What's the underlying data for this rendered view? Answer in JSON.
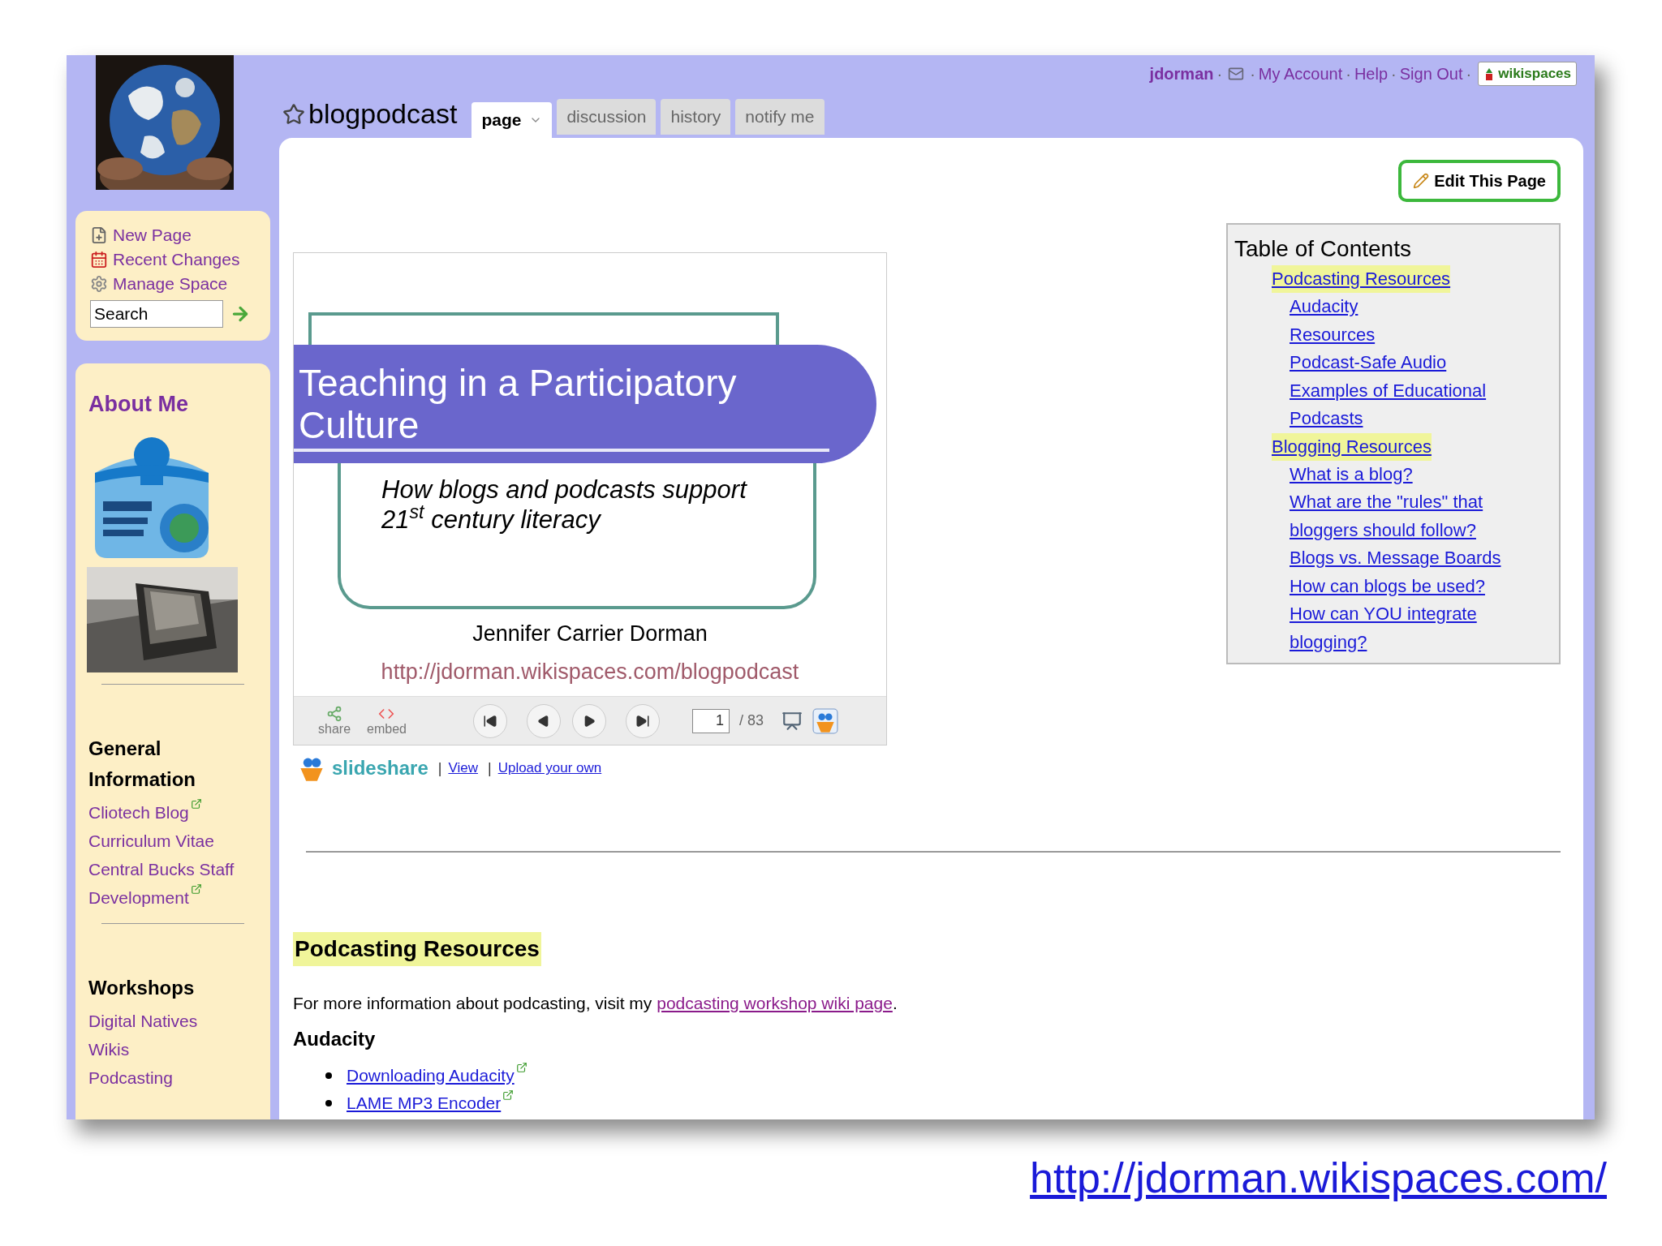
{
  "user_bar": {
    "username": "jdorman",
    "links": [
      "My Account",
      "Help",
      "Sign Out"
    ],
    "brand": "wikispaces",
    "separator": "·"
  },
  "page_title": "blogpodcast",
  "tabs": [
    {
      "label": "page",
      "selected": true,
      "dropdown": true
    },
    {
      "label": "discussion",
      "selected": false,
      "dropdown": false
    },
    {
      "label": "history",
      "selected": false,
      "dropdown": false
    },
    {
      "label": "notify me",
      "selected": false,
      "dropdown": false
    }
  ],
  "sidebar": {
    "actions": [
      {
        "label": "New Page",
        "kind": "new"
      },
      {
        "label": "Recent Changes",
        "kind": "calendar"
      },
      {
        "label": "Manage Space",
        "kind": "gear"
      }
    ],
    "search": {
      "value": "Search"
    },
    "about_title": "About Me",
    "sections": [
      {
        "title": "General Information",
        "links": [
          {
            "label": "Cliotech Blog",
            "external": true
          },
          {
            "label": "Curriculum Vitae",
            "external": false
          },
          {
            "label": "Central Bucks Staff Development",
            "external": true
          }
        ]
      },
      {
        "title": "Workshops",
        "links": [
          {
            "label": "Digital Natives",
            "external": false
          },
          {
            "label": "Wikis",
            "external": false
          },
          {
            "label": "Podcasting",
            "external": false
          }
        ]
      }
    ]
  },
  "edit_button": "Edit This Page",
  "slideshow": {
    "title": "Teaching in a Participatory Culture",
    "subtitle": "How blogs and podcasts support 21$^{st}$ century literacy",
    "author": "Jennifer Carrier Dorman",
    "url": "http://jdorman.wikispaces.com/blogpodcast",
    "controls": {
      "share": "share",
      "embed": "embed",
      "page": "1",
      "total": "/ 83"
    },
    "brand": "slideshare",
    "separator": "|",
    "links": [
      "View",
      "Upload your own"
    ]
  },
  "toc": {
    "title": "Table of Contents",
    "items": [
      {
        "label": "Podcasting Resources",
        "children": [
          {
            "label": "Audacity"
          },
          {
            "label": "Resources"
          },
          {
            "label": "Podcast-Safe Audio"
          },
          {
            "label": "Examples of Educational Podcasts"
          }
        ]
      },
      {
        "label": "Blogging Resources",
        "children": [
          {
            "label": "What is a blog?"
          },
          {
            "label": "What are the \"rules\" that bloggers should follow?"
          },
          {
            "label": "Blogs vs. Message Boards"
          },
          {
            "label": "How can blogs be used?"
          },
          {
            "label": "How can YOU integrate blogging?"
          }
        ]
      }
    ]
  },
  "content": {
    "heading": "Podcasting Resources",
    "paragraph": {
      "before": "For more information about podcasting, visit my ",
      "link": "podcasting workshop wiki page",
      "after": "."
    },
    "subheading": "Audacity",
    "bullets": [
      {
        "label": "Downloading Audacity",
        "external": true
      },
      {
        "label": "LAME MP3 Encoder",
        "external": true
      }
    ]
  },
  "caption_link": "http://jdorman.wikispaces.com/"
}
